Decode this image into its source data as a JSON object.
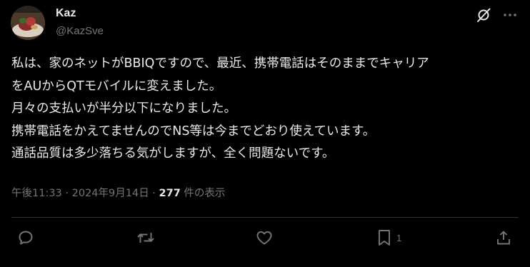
{
  "user": {
    "display_name": "Kaz",
    "handle": "@KazSve"
  },
  "tweet": {
    "lines": [
      "私は、家のネットがBBIQですので、最近、携帯電話はそのままでキャリア",
      "をAUからQTモバイルに変えました。",
      "月々の支払いが半分以下になりました。",
      "携帯電話をかえてませんのでNS等は今までどおり使えています。",
      "通話品質は多少落ちる気がしますが、全く問題ないです。"
    ],
    "timestamp": "午後11:33 · 2024年9月14日 · ",
    "views": "277",
    "views_label": " 件の表示"
  },
  "actions": {
    "bookmark_count": "1"
  },
  "icons": {
    "header": [
      "grok-icon",
      "more-icon"
    ],
    "actions": [
      "reply-icon",
      "retweet-icon",
      "like-icon",
      "bookmark-icon",
      "share-icon"
    ]
  },
  "colors": {
    "background": "#000000",
    "text": "#e7e9ea",
    "secondary": "#71767b",
    "divider": "#2f3336"
  }
}
